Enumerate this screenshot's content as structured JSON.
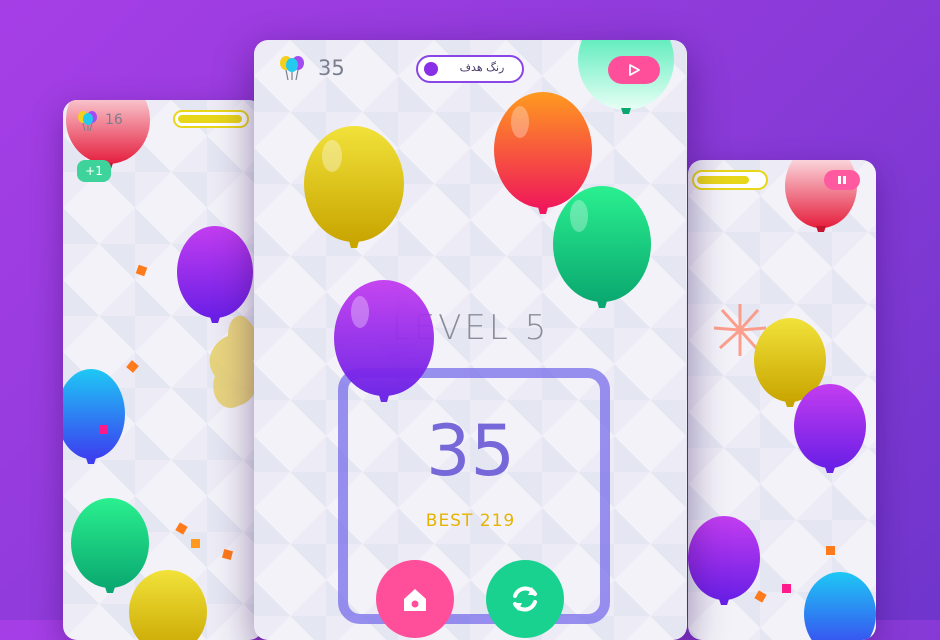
{
  "main": {
    "balloon_count": "35",
    "target_label": "رنگ هدف",
    "level_label": "LEVEL 5",
    "score": "35",
    "best_label": "BEST 219"
  },
  "left": {
    "balloon_count": "16",
    "bonus": "+1"
  },
  "icons": [
    "balloons-icon",
    "play-icon",
    "pause-icon",
    "home-icon",
    "restart-icon"
  ],
  "colors": {
    "background": "#9a3be0",
    "accent_purple": "#7668d8",
    "best_yellow": "#e6b400",
    "home_button": "#ff4f9a",
    "restart_button": "#19d28f"
  }
}
